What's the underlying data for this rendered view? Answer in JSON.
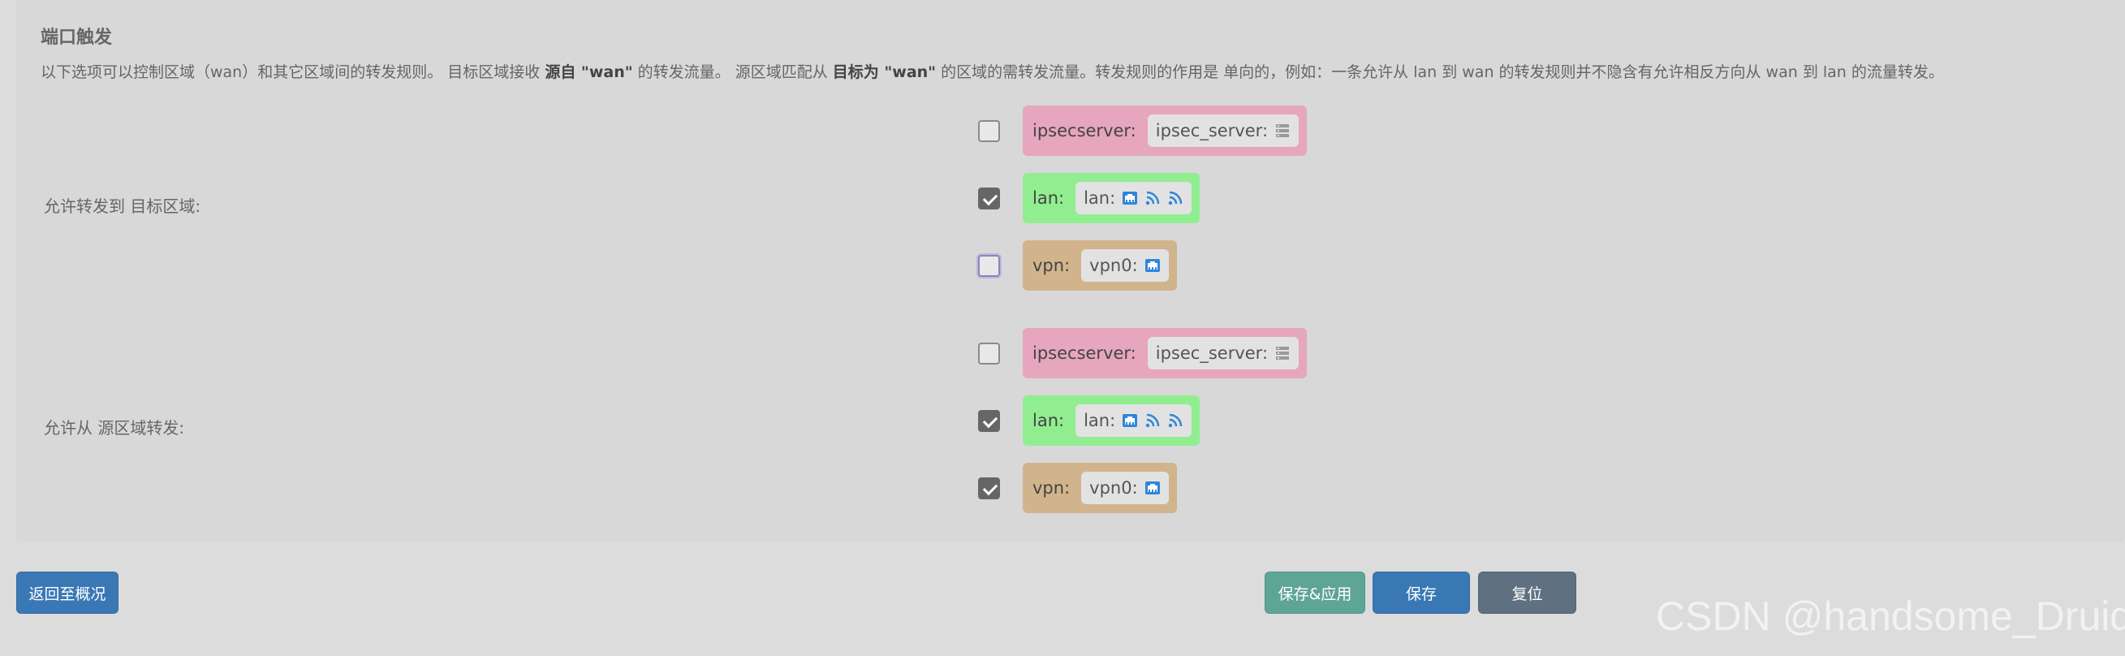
{
  "section": {
    "title": "端口触发",
    "desc_parts": {
      "p1": "以下选项可以控制区域（wan）和其它区域间的转发规则。  目标区域接收 ",
      "b1": "源自 \"wan\"",
      "p2": " 的转发流量。  源区域匹配从 ",
      "b2": "目标为 \"wan\"",
      "p3": " 的区域的需转发流量。转发规则的作用是  单向的，例如：一条允许从 lan 到 wan 的转发规则并不隐含有允许相反方向从 wan 到 lan 的流量转发。"
    }
  },
  "forward_to": {
    "label": "允许转发到  目标区域:",
    "zones": [
      {
        "name": "ipsecserver:",
        "checked": false,
        "iface": "ipsec_server:"
      },
      {
        "name": "lan:",
        "checked": true,
        "iface": "lan:"
      },
      {
        "name": "vpn:",
        "checked": false,
        "iface": "vpn0:"
      }
    ]
  },
  "forward_from": {
    "label": "允许从  源区域转发:",
    "zones": [
      {
        "name": "ipsecserver:",
        "checked": false,
        "iface": "ipsec_server:"
      },
      {
        "name": "lan:",
        "checked": true,
        "iface": "lan:"
      },
      {
        "name": "vpn:",
        "checked": true,
        "iface": "vpn0:"
      }
    ]
  },
  "buttons": {
    "back": "返回至概况",
    "save_apply": "保存&应用",
    "save": "保存",
    "reset": "复位"
  },
  "watermark": "CSDN @handsome_Druid",
  "colors": {
    "ipsecserver": "#e6a6bd",
    "lan": "#90ee90",
    "vpn": "#d2b48c",
    "btn_blue": "#3a78b5",
    "btn_teal": "#5fa596",
    "btn_gray": "#5f7080"
  },
  "icons": [
    "server-icon",
    "ethernet-port-icon",
    "wifi-icon"
  ]
}
